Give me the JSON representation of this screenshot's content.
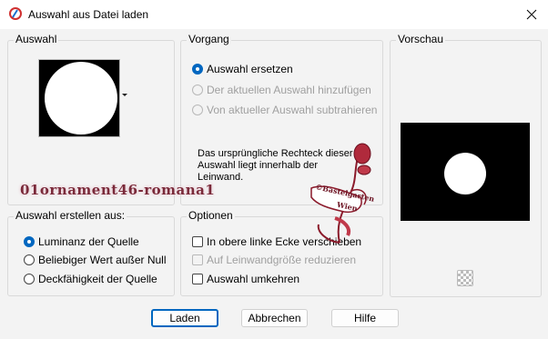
{
  "window": {
    "title": "Auswahl aus Datei laden",
    "app_icon": "paint-shop-pro-icon",
    "close_icon": "close-icon"
  },
  "groups": {
    "auswahl": {
      "title": "Auswahl",
      "shape_dropdown_icon": "chevron-down-icon"
    },
    "vorgang": {
      "title": "Vorgang",
      "options": [
        "Auswahl ersetzen",
        "Der aktuellen Auswahl hinzufügen",
        "Von aktueller Auswahl subtrahieren"
      ],
      "selected": "Auswahl ersetzen"
    },
    "vorschau": {
      "title": "Vorschau",
      "transparency_icon": "checkerboard-icon"
    },
    "erstellen": {
      "title": "Auswahl erstellen aus:",
      "options": [
        "Luminanz der Quelle",
        "Beliebiger Wert außer Null",
        "Deckfähigkeit der Quelle"
      ],
      "selected": "Luminanz der Quelle"
    },
    "optionen": {
      "title": "Optionen",
      "checkboxes": [
        "In obere linke Ecke verschieben",
        "Auf Leinwandgröße reduzieren",
        "Auswahl umkehren"
      ]
    }
  },
  "info_text": "Das ursprüngliche Rechteck dieser Auswahl liegt innerhalb der Leinwand.",
  "watermark": {
    "text": "01ornament46-romana1",
    "badge_line1": "©Bastelgarten",
    "badge_line2": "Wien"
  },
  "buttons": {
    "ok": "Laden",
    "cancel": "Abbrechen",
    "help": "Hilfe"
  },
  "colors": {
    "accent": "#0067c0",
    "preview_bg": "#000000",
    "watermark": "#7a2a3a"
  }
}
